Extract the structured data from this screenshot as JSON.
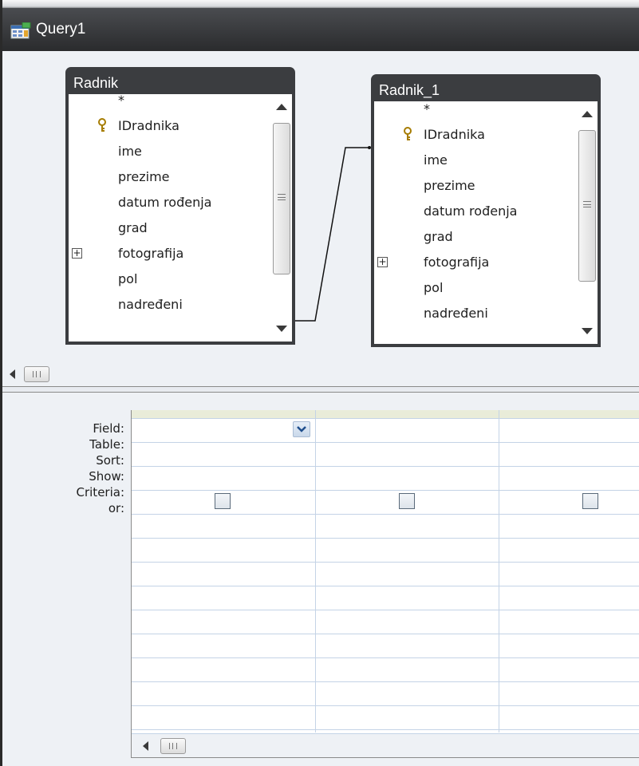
{
  "window": {
    "title": "Query1",
    "icon": "query-icon"
  },
  "tables": [
    {
      "name": "Radnik",
      "fields": [
        "*",
        "IDradnika",
        "ime",
        "prezime",
        "datum rođenja",
        "grad",
        "fotografija",
        "pol",
        "nadređeni"
      ]
    },
    {
      "name": "Radnik_1",
      "fields": [
        "*",
        "IDradnika",
        "ime",
        "prezime",
        "datum rođenja",
        "grad",
        "fotografija",
        "pol",
        "nadređeni"
      ]
    }
  ],
  "grid": {
    "row_labels": {
      "field": "Field:",
      "table": "Table:",
      "sort": "Sort:",
      "show": "Show:",
      "criteria": "Criteria:",
      "or": "or:"
    }
  },
  "colors": {
    "title_bar": "#2d2e30",
    "table_header": "#3b3d40",
    "grid_line": "#c4d3e6",
    "background": "#eef1f5"
  }
}
